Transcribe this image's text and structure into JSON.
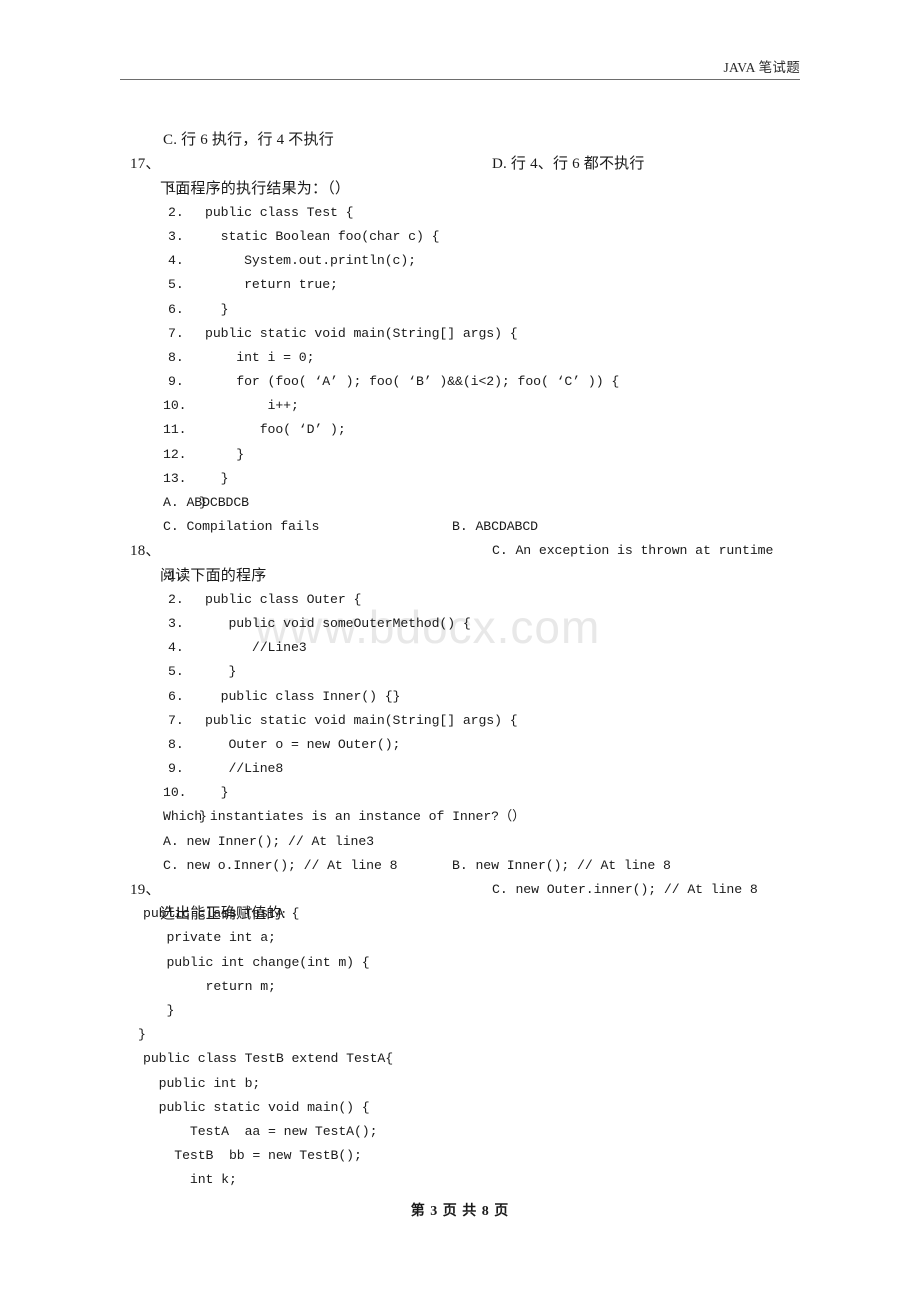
{
  "header": {
    "title": "JAVA 笔试题"
  },
  "watermark": "www.bdocx.com",
  "footer": {
    "text": "第 3 页 共 8 页"
  },
  "carryover_options": {
    "option_c": "C. 行 6 执行，行 4 不执行",
    "option_d": "D. 行 4、行 6 都不执行"
  },
  "q17": {
    "number": "17、",
    "prompt": "下面程序的执行结果为：（）",
    "code": [
      {
        "n": "1.",
        "text": "public class Test {"
      },
      {
        "n": "2.",
        "text": "  static Boolean foo(char c) {"
      },
      {
        "n": "3.",
        "text": "     System.out.println(c);"
      },
      {
        "n": "4.",
        "text": "     return true;"
      },
      {
        "n": "5.",
        "text": "  }"
      },
      {
        "n": "6.",
        "text": "public static void main(String[] args) {"
      },
      {
        "n": "7.",
        "text": "    int i = 0;"
      },
      {
        "n": "8.",
        "text": "    for (foo( ‘A’ ); foo( ‘B’ )&&(i<2); foo( ‘C’ )) {"
      },
      {
        "n": "9.",
        "text": "        i++;"
      },
      {
        "n": "10.",
        "text": "       foo( ‘D’ );"
      },
      {
        "n": "11.",
        "text": "    }"
      },
      {
        "n": "12.",
        "text": "  }"
      },
      {
        "n": "13.",
        "text": "}"
      }
    ],
    "options": [
      {
        "left": "A. ABDCBDCB",
        "right": "B. ABCDABCD"
      },
      {
        "left": "C. Compilation fails",
        "right": "C. An exception is thrown at runtime"
      }
    ]
  },
  "q18": {
    "number": "18、",
    "prompt": "阅读下面的程序",
    "code": [
      {
        "n": "1.",
        "text": "public class Outer {"
      },
      {
        "n": "2.",
        "text": "   public void someOuterMethod() {"
      },
      {
        "n": "3.",
        "text": "      //Line3"
      },
      {
        "n": "4.",
        "text": "   }"
      },
      {
        "n": "5.",
        "text": "  public class Inner() {}"
      },
      {
        "n": "6.",
        "text": "public static void main(String[] args) {"
      },
      {
        "n": "7.",
        "text": "   Outer o = new Outer();"
      },
      {
        "n": "8.",
        "text": "   //Line8"
      },
      {
        "n": "9.",
        "text": "  }"
      },
      {
        "n": "10.",
        "text": "}"
      }
    ],
    "question": "Which instantiates is an instance of Inner?（）",
    "options": [
      {
        "left": "A. new Inner(); // At line3",
        "right": "B. new Inner(); // At line 8"
      },
      {
        "left": "C. new o.Inner(); // At line 8",
        "right": "C. new Outer.inner(); // At line 8"
      }
    ]
  },
  "q19": {
    "number": "19、",
    "prompt": "选出能正确赋值的:",
    "code": [
      "public class TestA {",
      "   private int a;",
      "   public int change(int m) {",
      "        return m;",
      "   }",
      "}",
      "public class TestB extend TestA{",
      "  public int b;",
      "  public static void main() {",
      "      TestA  aa = new TestA();",
      "    TestB  bb = new TestB();",
      "      int k;"
    ]
  }
}
